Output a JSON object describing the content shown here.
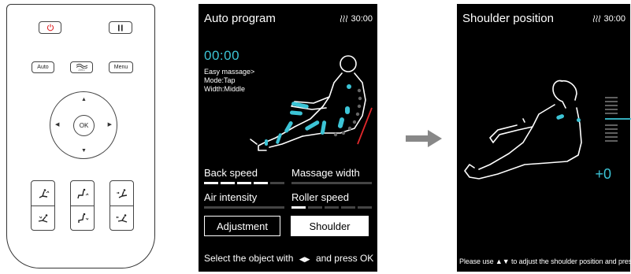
{
  "remote": {
    "buttons": {
      "auto": "Auto",
      "menu": "Menu",
      "zero_g": "Zero",
      "ok": "OK"
    }
  },
  "screen1": {
    "title": "Auto program",
    "timer": "30:00",
    "clock": "00:00",
    "info": [
      "Easy massage>",
      "Mode:Tap",
      "Width:Middle"
    ],
    "options": {
      "back_speed": "Back speed",
      "massage_width": "Massage width",
      "air_intensity": "Air intensity",
      "roller_speed": "Roller speed"
    },
    "back_speed_level": 4,
    "back_speed_max": 5,
    "roller_speed_level": 1,
    "roller_speed_max": 5,
    "buttons": {
      "adjustment": "Adjustment",
      "shoulder": "Shoulder"
    },
    "footer_pre": "Select the object with",
    "footer_post": "and press OK"
  },
  "screen2": {
    "title": "Shoulder position",
    "timer": "30:00",
    "value": "+0",
    "footer": "Please use ▲▼ to adjust the shoulder position and press OK"
  },
  "colors": {
    "accent": "#3cc4d6",
    "warning": "#e0282b",
    "power": "#e0282b"
  }
}
